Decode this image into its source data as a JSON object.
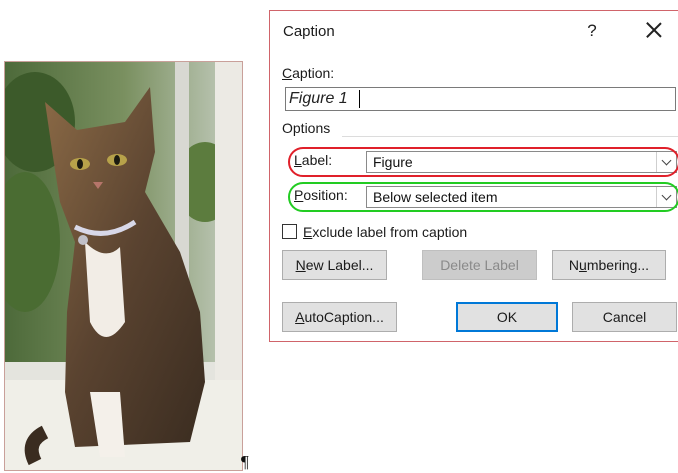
{
  "document": {
    "paragraph_mark": "¶"
  },
  "dialog": {
    "title": "Caption",
    "help_label": "?",
    "caption_label": "Caption:",
    "caption_value": "Figure 1",
    "options_label": "Options",
    "label_field": {
      "label": "Label:",
      "value": "Figure"
    },
    "position_field": {
      "label": "Position:",
      "value": "Below selected item"
    },
    "exclude_label": "Exclude label from caption",
    "exclude_checked": false,
    "buttons": {
      "new_label": "New Label...",
      "delete_label": "Delete Label",
      "numbering": "Numbering...",
      "autocaption": "AutoCaption...",
      "ok": "OK",
      "cancel": "Cancel"
    },
    "highlight_colors": {
      "label_row": "#e0202a",
      "position_row": "#22cc22"
    }
  }
}
